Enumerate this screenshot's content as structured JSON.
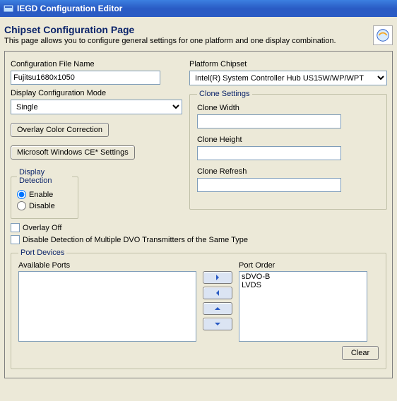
{
  "window": {
    "title": "IEGD Configuration Editor"
  },
  "header": {
    "title": "Chipset Configuration Page",
    "description": "This page allows you to configure general settings for one platform and one display combination."
  },
  "config_file": {
    "label": "Configuration File Name",
    "value": "Fujitsu1680x1050"
  },
  "platform_chipset": {
    "label": "Platform Chipset",
    "value": "Intel(R) System Controller Hub US15W/WP/WPT"
  },
  "display_mode": {
    "label": "Display Configuration Mode",
    "value": "Single"
  },
  "buttons": {
    "overlay_color": "Overlay Color Correction",
    "wince": "Microsoft Windows CE* Settings",
    "clear": "Clear"
  },
  "clone": {
    "legend": "Clone Settings",
    "width_label": "Clone Width",
    "width_value": "",
    "height_label": "Clone Height",
    "height_value": "",
    "refresh_label": "Clone Refresh",
    "refresh_value": ""
  },
  "detection": {
    "legend": "Display Detection",
    "enable_label": "Enable",
    "disable_label": "Disable",
    "value": "enable"
  },
  "checkboxes": {
    "overlay_off_label": "Overlay Off",
    "overlay_off_checked": false,
    "disable_dvo_label": "Disable Detection of Multiple DVO Transmitters of the Same Type",
    "disable_dvo_checked": false
  },
  "port_devices": {
    "legend": "Port Devices",
    "available_label": "Available Ports",
    "available": [],
    "order_label": "Port Order",
    "order": [
      "sDVO-B",
      "LVDS"
    ]
  }
}
